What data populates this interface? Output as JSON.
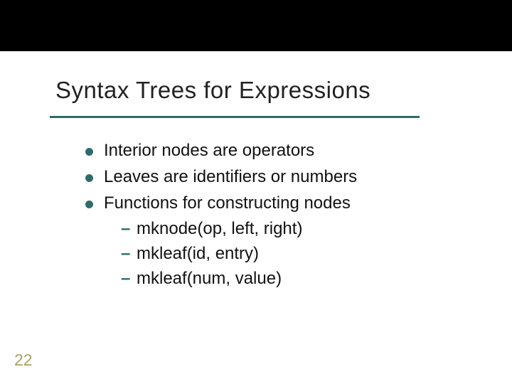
{
  "title": "Syntax Trees for Expressions",
  "bullets": {
    "b0": "Interior nodes are operators",
    "b1": "Leaves are identifiers or numbers",
    "b2": "Functions for constructing nodes"
  },
  "subs": {
    "s0": "mknode(op, left, right)",
    "s1": "mkleaf(id, entry)",
    "s2": "mkleaf(num, value)"
  },
  "page_number": "22",
  "colors": {
    "accent": "#2f6b6b",
    "page_num": "#a9a264"
  }
}
